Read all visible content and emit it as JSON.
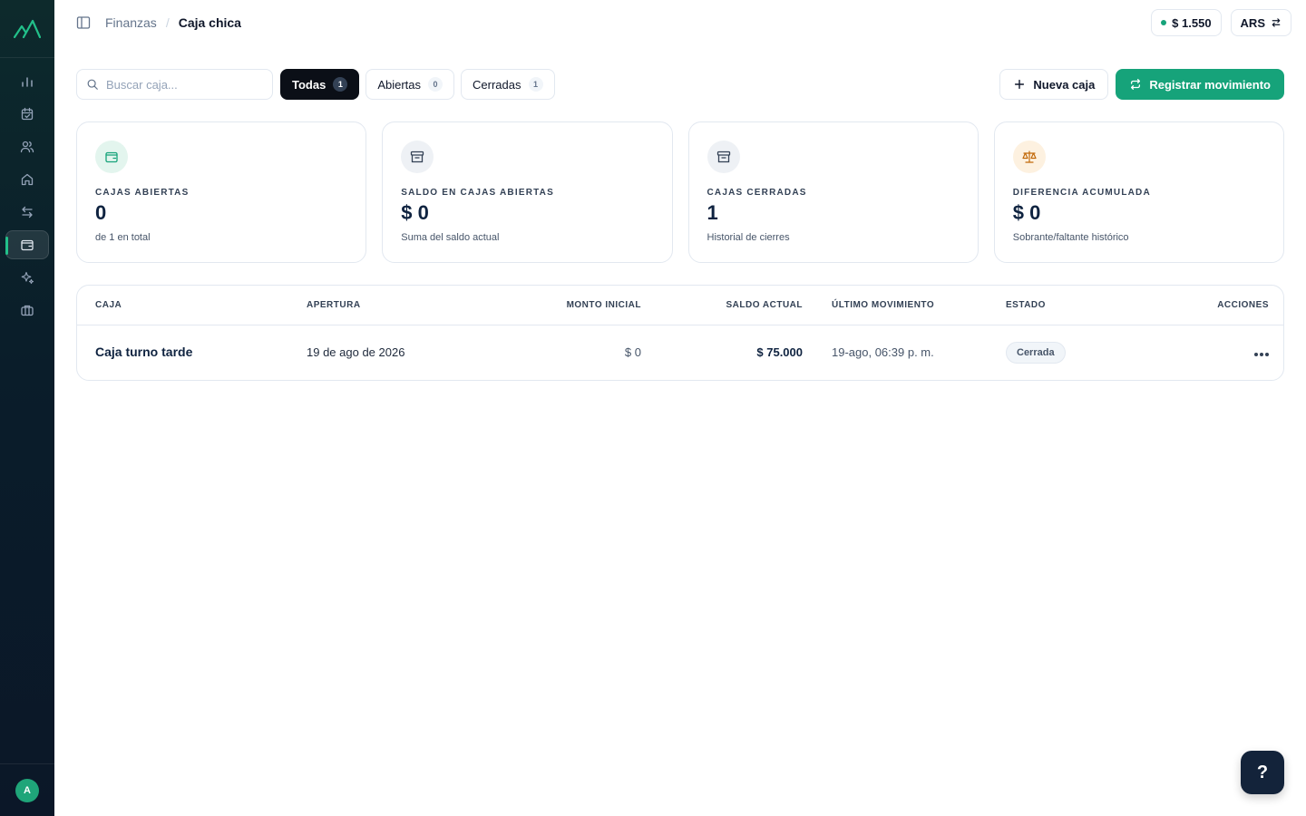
{
  "sidebar": {
    "logo": "mountain-logo",
    "items": [
      {
        "icon": "bar-chart-icon",
        "active": false
      },
      {
        "icon": "calendar-check-icon",
        "active": false
      },
      {
        "icon": "users-icon",
        "active": false
      },
      {
        "icon": "home-icon",
        "active": false
      },
      {
        "icon": "arrows-exchange-icon",
        "active": false
      },
      {
        "icon": "wallet-icon",
        "active": true
      },
      {
        "icon": "sparkles-icon",
        "active": false
      },
      {
        "icon": "briefcase-icon",
        "active": false
      }
    ],
    "avatar": "A"
  },
  "header": {
    "breadcrumb": {
      "parent": "Finanzas",
      "separator": "/",
      "current": "Caja chica"
    },
    "balance": "$ 1.550",
    "currency": "ARS"
  },
  "toolbar": {
    "search_placeholder": "Buscar caja...",
    "filters": [
      {
        "label": "Todas",
        "count": "1",
        "active": true
      },
      {
        "label": "Abiertas",
        "count": "0",
        "active": false
      },
      {
        "label": "Cerradas",
        "count": "1",
        "active": false
      }
    ],
    "new_label": "Nueva caja",
    "register_label": "Registrar movimiento"
  },
  "cards": [
    {
      "icon": "wallet-icon",
      "label": "CAJAS ABIERTAS",
      "value": "0",
      "sub": "de 1 en total",
      "icon_bg": "#e3f5ee",
      "icon_color": "#16a37a"
    },
    {
      "icon": "archive-icon",
      "label": "SALDO EN CAJAS ABIERTAS",
      "value": "$ 0",
      "sub": "Suma del saldo actual",
      "icon_bg": "#eef1f5",
      "icon_color": "#334155"
    },
    {
      "icon": "archive-icon",
      "label": "CAJAS CERRADAS",
      "value": "1",
      "sub": "Historial de cierres",
      "icon_bg": "#eef1f5",
      "icon_color": "#334155"
    },
    {
      "icon": "scale-icon",
      "label": "DIFERENCIA ACUMULADA",
      "value": "$ 0",
      "sub": "Sobrante/faltante histórico",
      "icon_bg": "#fdf1e0",
      "icon_color": "#c26a0a"
    }
  ],
  "table": {
    "headers": [
      "CAJA",
      "APERTURA",
      "MONTO INICIAL",
      "SALDO ACTUAL",
      "ÚLTIMO MOVIMIENTO",
      "ESTADO",
      "ACCIONES"
    ],
    "rows": [
      {
        "name": "Caja turno tarde",
        "opening": "19 de ago de 2026",
        "initial": "$ 0",
        "balance": "$ 75.000",
        "last": "19-ago, 06:39 p. m.",
        "status": "Cerrada"
      }
    ]
  },
  "help_label": "?"
}
